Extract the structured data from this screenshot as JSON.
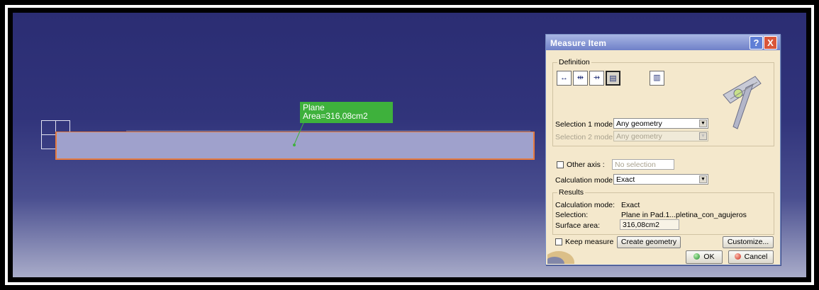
{
  "viewport": {
    "callout": {
      "line1": "Plane",
      "line2": "Area=316,08cm2"
    },
    "icons": {
      "axis": "axis-compass-icon"
    }
  },
  "dialog": {
    "title": "Measure Item",
    "help_label": "?",
    "close_label": "X",
    "definition": {
      "label": "Definition",
      "tool_icons": [
        "measure-between-icon",
        "measure-between-chain-icon",
        "measure-between-fan-icon",
        "measure-item-icon",
        "measure-thickness-icon"
      ],
      "selection1_label": "Selection 1 mode:",
      "selection1_value": "Any geometry",
      "selection2_label": "Selection 2 mode:",
      "selection2_value": "Any geometry",
      "other_axis_label": "Other axis :",
      "other_axis_placeholder": "No selection",
      "calc_mode_label": "Calculation mode:",
      "calc_mode_value": "Exact"
    },
    "results": {
      "label": "Results",
      "rows": [
        {
          "label": "Calculation mode:",
          "value": "Exact"
        },
        {
          "label": "Selection:",
          "value": "Plane in Pad.1...pletina_con_agujeros"
        },
        {
          "label": "Surface area:",
          "value": "316,08cm2"
        }
      ]
    },
    "keep_measure_label": "Keep measure",
    "create_geometry_label": "Create geometry",
    "customize_label": "Customize...",
    "ok_label": "OK",
    "cancel_label": "Cancel"
  },
  "colors": {
    "viewport_top": "#2b2d73",
    "plate_fill": "#9fa1cc",
    "plate_outline": "#e77a3d",
    "callout_bg": "#3eb13c",
    "dialog_bg": "#f4e8cc"
  }
}
